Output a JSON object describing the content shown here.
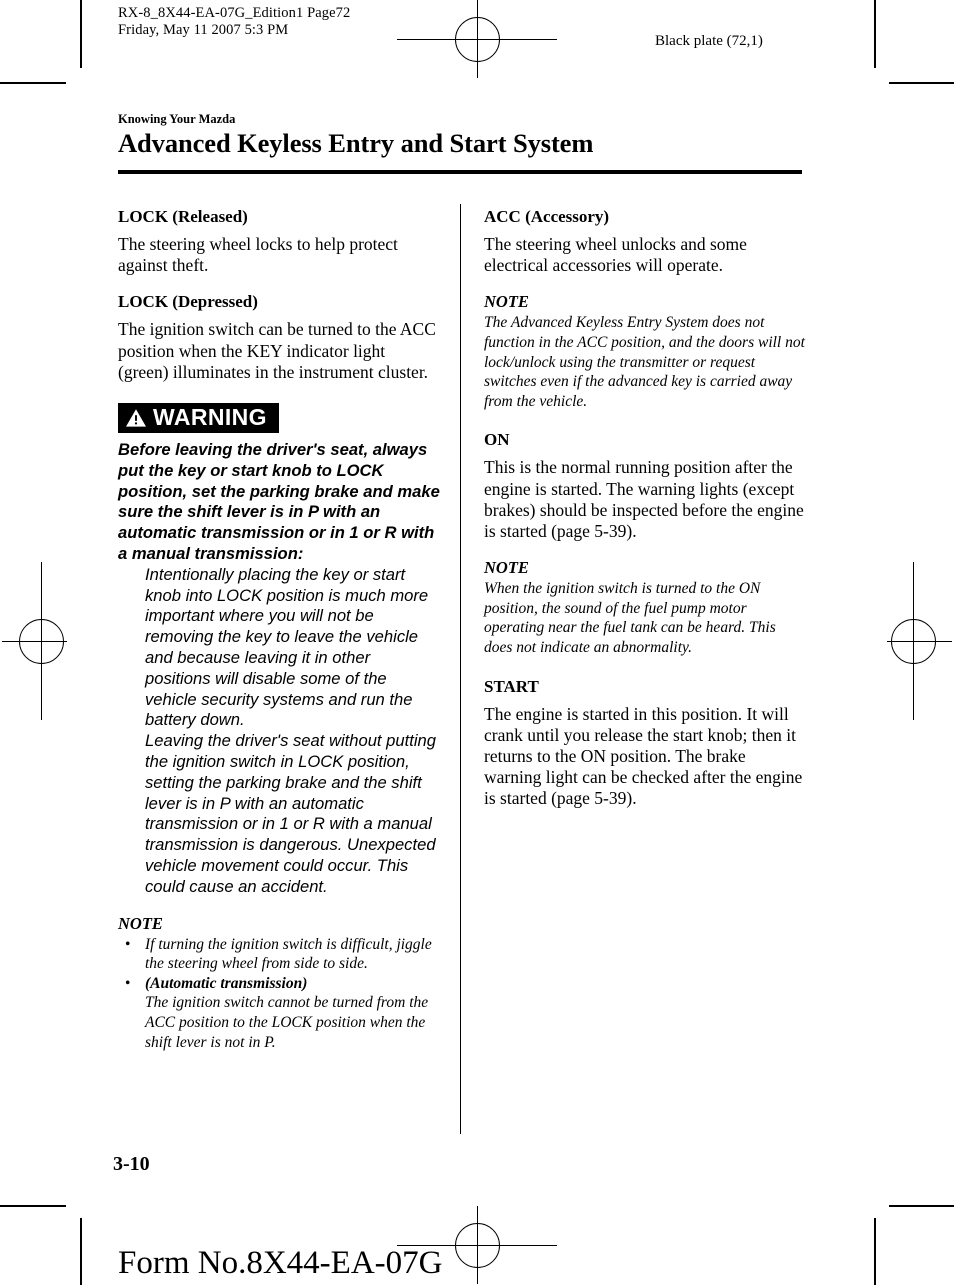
{
  "printing": {
    "doc_id_line1": "RX-8_8X44-EA-07G_Edition1 Page72",
    "doc_id_line2": "Friday, May 11 2007 5:3 PM",
    "black_plate": "Black plate (72,1)"
  },
  "title": {
    "eyebrow": "Knowing Your Mazda",
    "heading": "Advanced Keyless Entry and Start System"
  },
  "left_column": {
    "lock_released": {
      "heading": "LOCK (Released)",
      "body": "The steering wheel locks to help protect against theft."
    },
    "lock_depressed": {
      "heading": "LOCK (Depressed)",
      "body": "The ignition switch can be turned to the ACC position when the KEY indicator light (green) illuminates in the instrument cluster."
    },
    "warning": {
      "label": "WARNING",
      "icon": "warning-triangle-icon",
      "lead": "Before leaving the driver's seat, always put the key or start knob to LOCK position, set the parking brake and make sure the shift lever is in P with an automatic transmission or in 1 or R with a manual transmission:",
      "sub1": "Intentionally placing the key or start knob into LOCK position is much more important where you will not be removing the key to leave the vehicle and because leaving it in other positions will disable some of the vehicle security systems and run the battery down.",
      "sub2": "Leaving the driver's seat without putting the ignition switch in LOCK position, setting the parking brake and the shift lever is in P with an automatic transmission or in 1 or R with a manual transmission is dangerous. Unexpected vehicle movement could occur. This could cause an accident."
    },
    "note": {
      "label": "NOTE",
      "bullet_symbol": "•",
      "items": [
        {
          "emphasis": "",
          "text": "If turning the ignition switch is difficult, jiggle the steering wheel from side to side."
        },
        {
          "emphasis": "(Automatic transmission)",
          "text": "The ignition switch cannot be turned from the ACC position to the LOCK position when the shift lever is not in P."
        }
      ]
    }
  },
  "right_column": {
    "acc": {
      "heading": "ACC (Accessory)",
      "body": "The steering wheel unlocks and some electrical accessories will operate.",
      "note_label": "NOTE",
      "note_text": "The Advanced Keyless Entry System does not function in the ACC position, and the doors will not lock/unlock using the transmitter or request switches even if the advanced key is carried away from the vehicle."
    },
    "on": {
      "heading": "ON",
      "body": "This is the normal running position after the engine is started. The warning lights (except brakes) should be inspected before the engine is started (page 5-39).",
      "note_label": "NOTE",
      "note_text": "When the ignition switch is turned to the ON position, the sound of the fuel pump motor operating near the fuel tank can be heard. This does not indicate an abnormality."
    },
    "start": {
      "heading": "START",
      "body": "The engine is started in this position. It will crank until you release the start knob; then it returns to the ON position. The brake warning light can be checked after the engine is started (page 5-39)."
    }
  },
  "footer": {
    "page_number": "3-10",
    "form_number": "Form No.8X44-EA-07G"
  }
}
